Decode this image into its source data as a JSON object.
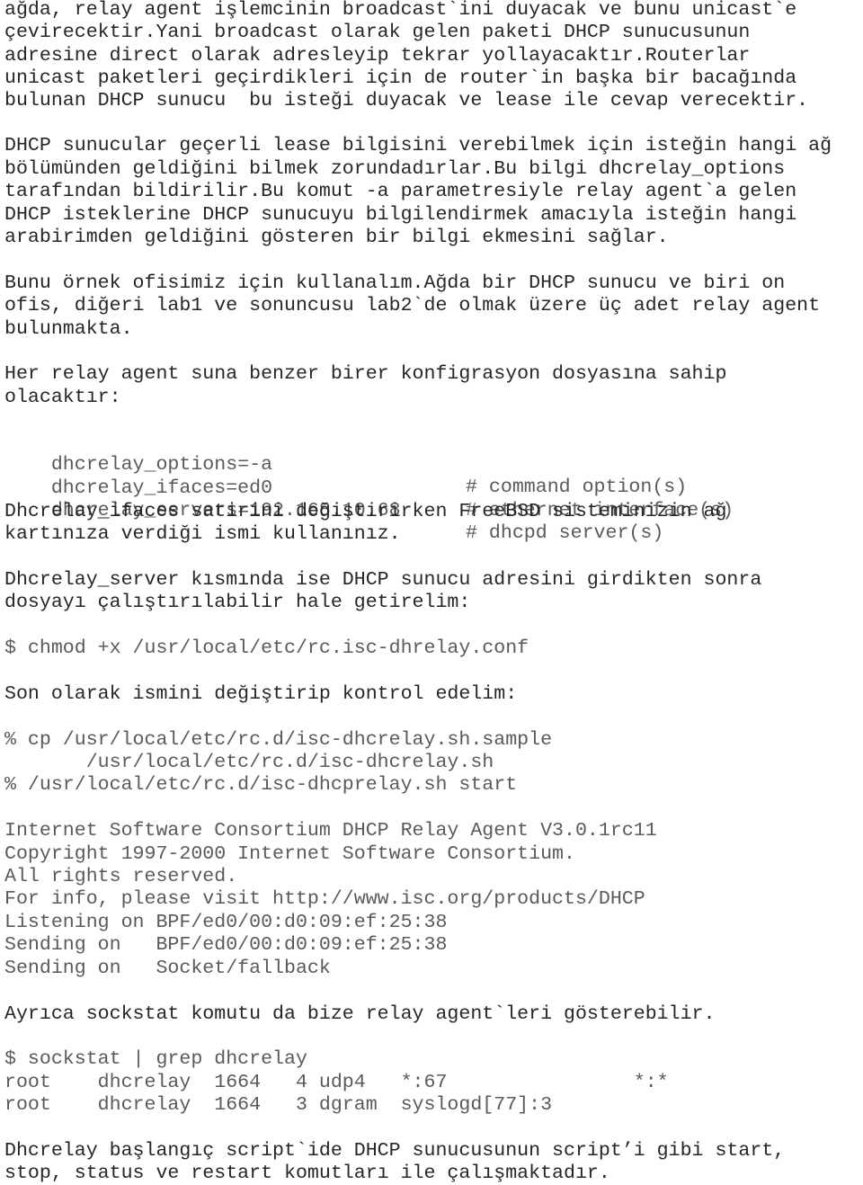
{
  "document": {
    "paragraphs": [
      {
        "id": "relay-broadcast",
        "lines": [
          "ağda, relay agent işlemcinin broadcast`ini duyacak ve bunu unicast`e",
          "çevirecektir.Yani broadcast olarak gelen paketi DHCP sunucusunun",
          "adresine direct olarak adresleyip tekrar yollayacaktır.Routerlar",
          "unicast paketleri geçirdikleri için de router`in başka bir bacağında",
          "bulunan DHCP sunucu  bu isteği duyacak ve lease ile cevap verecektir."
        ]
      },
      {
        "id": "lease-info",
        "lines": [
          "DHCP sunucular geçerli lease bilgisini verebilmek için isteğin hangi ağ",
          "bölümünden geldiğini bilmek zorundadırlar.Bu bilgi dhcrelay_options",
          "tarafından bildirilir.Bu komut -a parametresiyle relay agent`a gelen",
          "DHCP isteklerine DHCP sunucuyu bilgilendirmek amacıyla isteğin hangi",
          "arabirimden geldiğini gösteren bir bilgi ekmesini sağlar."
        ]
      },
      {
        "id": "office-example",
        "lines": [
          "Bunu örnek ofisimiz için kullanalım.Ağda bir DHCP sunucu ve biri on",
          "ofis, diğeri lab1 ve sonuncusu lab2`de olmak üzere üç adet relay agent",
          "bulunmakta."
        ]
      },
      {
        "id": "config-intro",
        "lines": [
          "Her relay agent suna benzer birer konfigrasyon dosyasına sahip",
          "olacaktır:"
        ]
      }
    ],
    "config": [
      {
        "setting": "dhcrelay_options=-a",
        "comment": "# command option(s)"
      },
      {
        "setting": "dhcrelay_ifaces=ed0",
        "comment": "# ethernet interface(s)"
      },
      {
        "setting": "dhcrelay_servers=192.168.10.68",
        "comment": "# dhcpd server(s)"
      }
    ],
    "ifaces_note": [
      "Dhcrelay_ifaces satirini değiştirirken FreeBSD sisteminizin ağ",
      "kartınıza verdiği ismi kullanınız."
    ],
    "server_note": [
      "Dhcrelay_server kısmında ise DHCP sunucu adresini girdikten sonra",
      "dosyayı çalıştırılabilir hale getirelim:"
    ],
    "chmod_command": "$ chmod +x /usr/local/etc/rc.isc-dhrelay.conf",
    "rename_note": "Son olarak ismini değiştirip kontrol edelim:",
    "cp_commands": [
      "% cp /usr/local/etc/rc.d/isc-dhcrelay.sh.sample",
      "       /usr/local/etc/rc.d/isc-dhcrelay.sh",
      "% /usr/local/etc/rc.d/isc-dhcprelay.sh start"
    ],
    "isc_output": [
      "Internet Software Consortium DHCP Relay Agent V3.0.1rc11",
      "Copyright 1997-2000 Internet Software Consortium.",
      "All rights reserved.",
      "For info, please visit http://www.isc.org/products/DHCP",
      "Listening on BPF/ed0/00:d0:09:ef:25:38",
      "Sending on   BPF/ed0/00:d0:09:ef:25:38",
      "Sending on   Socket/fallback"
    ],
    "sockstat_note": "Ayrıca sockstat komutu da bize relay agent`leri gösterebilir.",
    "sockstat_command": "$ sockstat | grep dhcrelay",
    "sockstat_rows": [
      "root    dhcrelay  1664   4 udp4   *:67                *:*",
      "root    dhcrelay  1664   3 dgram  syslogd[77]:3"
    ],
    "closing": [
      "Dhcrelay başlangıç script`ide DHCP sunucusunun script’i gibi start,",
      "stop, status ve restart komutları ile çalışmaktadır."
    ]
  }
}
